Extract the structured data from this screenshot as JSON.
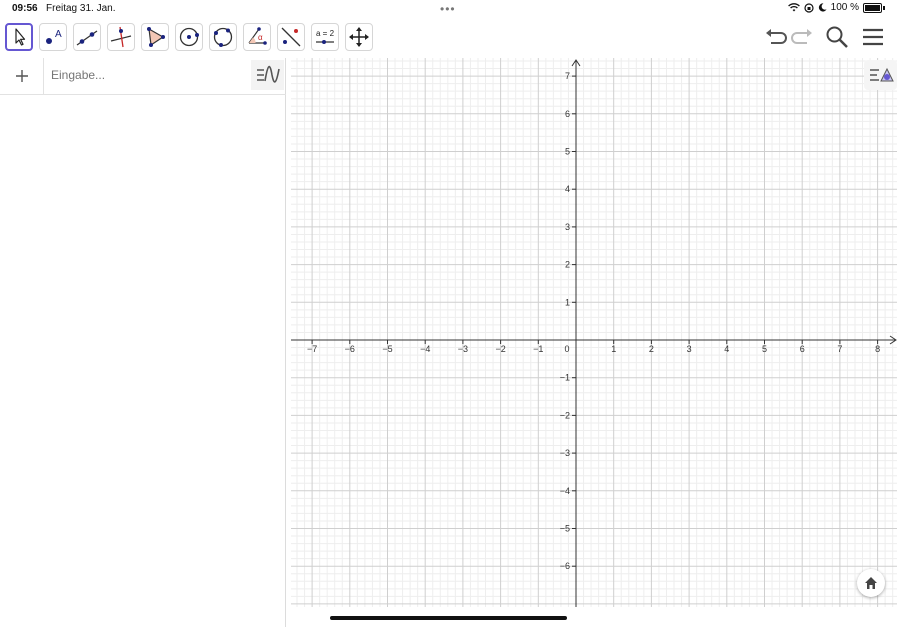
{
  "status_bar": {
    "time": "09:56",
    "date": "Freitag 31. Jan.",
    "battery": "100 %"
  },
  "toolbar": {
    "tools": [
      {
        "name": "move-tool-button",
        "icon": "arrow-pointer-icon",
        "active": true
      },
      {
        "name": "point-tool-button",
        "icon": "point-icon",
        "label": "A"
      },
      {
        "name": "line-tool-button",
        "icon": "line-through-points-icon"
      },
      {
        "name": "perpendicular-line-tool-button",
        "icon": "perpendicular-line-icon"
      },
      {
        "name": "polygon-tool-button",
        "icon": "polygon-icon"
      },
      {
        "name": "circle-center-point-tool-button",
        "icon": "circle-center-icon"
      },
      {
        "name": "circle-three-points-tool-button",
        "icon": "circle-three-points-icon"
      },
      {
        "name": "angle-tool-button",
        "icon": "angle-icon",
        "label": "α"
      },
      {
        "name": "reflect-tool-button",
        "icon": "reflect-about-line-icon"
      },
      {
        "name": "slider-tool-button",
        "icon": "slider-icon",
        "label": "a = 2"
      },
      {
        "name": "move-graphics-view-tool-button",
        "icon": "move-view-icon"
      }
    ],
    "colors": {
      "active_border": "#6557d2",
      "point": "#1a237e",
      "line": "#333333"
    }
  },
  "algebra": {
    "input_placeholder": "Eingabe..."
  },
  "graph": {
    "x_ticks": [
      "−7",
      "−6",
      "−5",
      "−4",
      "−3",
      "−2",
      "−1",
      "0",
      "1",
      "2",
      "3",
      "4",
      "5",
      "6",
      "7",
      "8"
    ],
    "y_ticks_positive": [
      "1",
      "2",
      "3",
      "4",
      "5",
      "6",
      "7"
    ],
    "y_ticks_negative": [
      "−1",
      "−2",
      "−3",
      "−4",
      "−5",
      "−6"
    ],
    "grid": true,
    "minor_grid": true
  }
}
